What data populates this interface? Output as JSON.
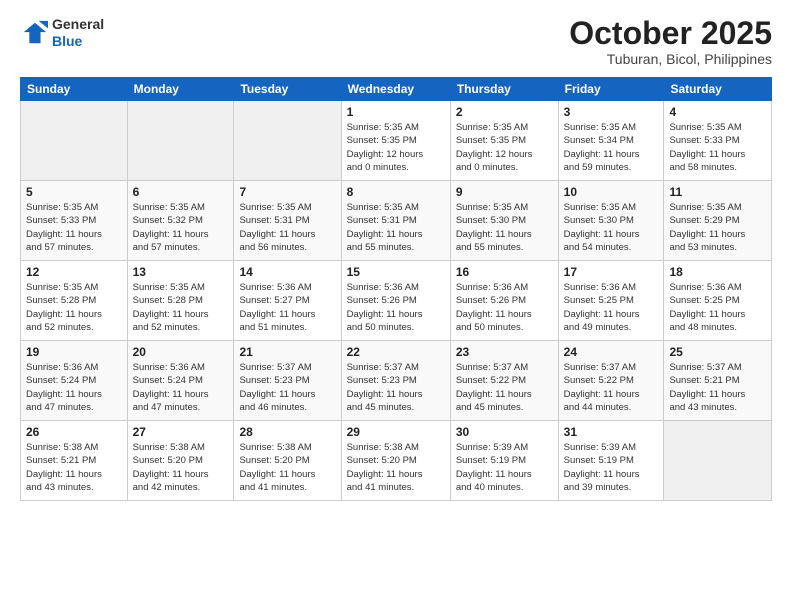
{
  "header": {
    "logo_line1": "General",
    "logo_line2": "Blue",
    "month": "October 2025",
    "location": "Tuburan, Bicol, Philippines"
  },
  "weekdays": [
    "Sunday",
    "Monday",
    "Tuesday",
    "Wednesday",
    "Thursday",
    "Friday",
    "Saturday"
  ],
  "weeks": [
    [
      {
        "day": "",
        "info": ""
      },
      {
        "day": "",
        "info": ""
      },
      {
        "day": "",
        "info": ""
      },
      {
        "day": "1",
        "info": "Sunrise: 5:35 AM\nSunset: 5:35 PM\nDaylight: 12 hours\nand 0 minutes."
      },
      {
        "day": "2",
        "info": "Sunrise: 5:35 AM\nSunset: 5:35 PM\nDaylight: 12 hours\nand 0 minutes."
      },
      {
        "day": "3",
        "info": "Sunrise: 5:35 AM\nSunset: 5:34 PM\nDaylight: 11 hours\nand 59 minutes."
      },
      {
        "day": "4",
        "info": "Sunrise: 5:35 AM\nSunset: 5:33 PM\nDaylight: 11 hours\nand 58 minutes."
      }
    ],
    [
      {
        "day": "5",
        "info": "Sunrise: 5:35 AM\nSunset: 5:33 PM\nDaylight: 11 hours\nand 57 minutes."
      },
      {
        "day": "6",
        "info": "Sunrise: 5:35 AM\nSunset: 5:32 PM\nDaylight: 11 hours\nand 57 minutes."
      },
      {
        "day": "7",
        "info": "Sunrise: 5:35 AM\nSunset: 5:31 PM\nDaylight: 11 hours\nand 56 minutes."
      },
      {
        "day": "8",
        "info": "Sunrise: 5:35 AM\nSunset: 5:31 PM\nDaylight: 11 hours\nand 55 minutes."
      },
      {
        "day": "9",
        "info": "Sunrise: 5:35 AM\nSunset: 5:30 PM\nDaylight: 11 hours\nand 55 minutes."
      },
      {
        "day": "10",
        "info": "Sunrise: 5:35 AM\nSunset: 5:30 PM\nDaylight: 11 hours\nand 54 minutes."
      },
      {
        "day": "11",
        "info": "Sunrise: 5:35 AM\nSunset: 5:29 PM\nDaylight: 11 hours\nand 53 minutes."
      }
    ],
    [
      {
        "day": "12",
        "info": "Sunrise: 5:35 AM\nSunset: 5:28 PM\nDaylight: 11 hours\nand 52 minutes."
      },
      {
        "day": "13",
        "info": "Sunrise: 5:35 AM\nSunset: 5:28 PM\nDaylight: 11 hours\nand 52 minutes."
      },
      {
        "day": "14",
        "info": "Sunrise: 5:36 AM\nSunset: 5:27 PM\nDaylight: 11 hours\nand 51 minutes."
      },
      {
        "day": "15",
        "info": "Sunrise: 5:36 AM\nSunset: 5:26 PM\nDaylight: 11 hours\nand 50 minutes."
      },
      {
        "day": "16",
        "info": "Sunrise: 5:36 AM\nSunset: 5:26 PM\nDaylight: 11 hours\nand 50 minutes."
      },
      {
        "day": "17",
        "info": "Sunrise: 5:36 AM\nSunset: 5:25 PM\nDaylight: 11 hours\nand 49 minutes."
      },
      {
        "day": "18",
        "info": "Sunrise: 5:36 AM\nSunset: 5:25 PM\nDaylight: 11 hours\nand 48 minutes."
      }
    ],
    [
      {
        "day": "19",
        "info": "Sunrise: 5:36 AM\nSunset: 5:24 PM\nDaylight: 11 hours\nand 47 minutes."
      },
      {
        "day": "20",
        "info": "Sunrise: 5:36 AM\nSunset: 5:24 PM\nDaylight: 11 hours\nand 47 minutes."
      },
      {
        "day": "21",
        "info": "Sunrise: 5:37 AM\nSunset: 5:23 PM\nDaylight: 11 hours\nand 46 minutes."
      },
      {
        "day": "22",
        "info": "Sunrise: 5:37 AM\nSunset: 5:23 PM\nDaylight: 11 hours\nand 45 minutes."
      },
      {
        "day": "23",
        "info": "Sunrise: 5:37 AM\nSunset: 5:22 PM\nDaylight: 11 hours\nand 45 minutes."
      },
      {
        "day": "24",
        "info": "Sunrise: 5:37 AM\nSunset: 5:22 PM\nDaylight: 11 hours\nand 44 minutes."
      },
      {
        "day": "25",
        "info": "Sunrise: 5:37 AM\nSunset: 5:21 PM\nDaylight: 11 hours\nand 43 minutes."
      }
    ],
    [
      {
        "day": "26",
        "info": "Sunrise: 5:38 AM\nSunset: 5:21 PM\nDaylight: 11 hours\nand 43 minutes."
      },
      {
        "day": "27",
        "info": "Sunrise: 5:38 AM\nSunset: 5:20 PM\nDaylight: 11 hours\nand 42 minutes."
      },
      {
        "day": "28",
        "info": "Sunrise: 5:38 AM\nSunset: 5:20 PM\nDaylight: 11 hours\nand 41 minutes."
      },
      {
        "day": "29",
        "info": "Sunrise: 5:38 AM\nSunset: 5:20 PM\nDaylight: 11 hours\nand 41 minutes."
      },
      {
        "day": "30",
        "info": "Sunrise: 5:39 AM\nSunset: 5:19 PM\nDaylight: 11 hours\nand 40 minutes."
      },
      {
        "day": "31",
        "info": "Sunrise: 5:39 AM\nSunset: 5:19 PM\nDaylight: 11 hours\nand 39 minutes."
      },
      {
        "day": "",
        "info": ""
      }
    ]
  ]
}
